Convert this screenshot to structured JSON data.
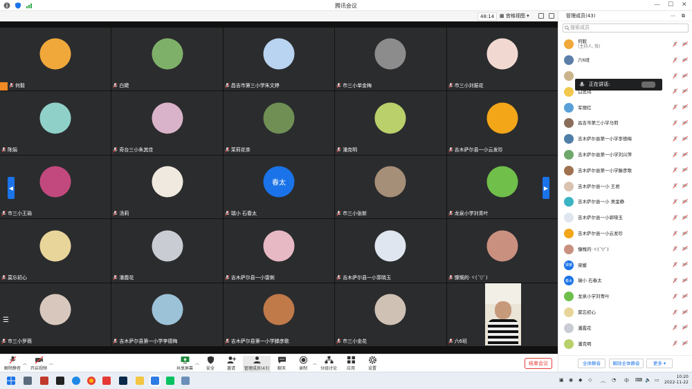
{
  "window": {
    "title": "腾讯会议"
  },
  "subbar": {
    "timer": "48:14",
    "view_label": "宫格视图"
  },
  "tiles": [
    {
      "name": "何毅",
      "avatar_color": "#f0a83a",
      "host": true
    },
    {
      "name": "白婕",
      "avatar_color": "#7fb069"
    },
    {
      "name": "昌吉市第三小学朱文婷",
      "avatar_color": "#b9d4f0"
    },
    {
      "name": "市三小单金梅",
      "avatar_color": "#8c8c8c"
    },
    {
      "name": "市三小刘振花",
      "avatar_color": "#f1d9d1"
    },
    {
      "name": "陈娟",
      "avatar_color": "#8fd1c8"
    },
    {
      "name": "奇台三小朱其佳",
      "avatar_color": "#d9b3c9"
    },
    {
      "name": "茉莉花茶",
      "avatar_color": "#6f8f55"
    },
    {
      "name": "潘克明",
      "avatar_color": "#b9d06b"
    },
    {
      "name": "吉木萨尔县一小云发珍",
      "avatar_color": "#f2a618"
    },
    {
      "name": "市三小王瑜",
      "avatar_color": "#c2497d"
    },
    {
      "name": "汤莉",
      "avatar_color": "#efe9df"
    },
    {
      "name": "瑞小 石春太",
      "avatar_text": "春太"
    },
    {
      "name": "市三小张新",
      "avatar_color": "#a68f78"
    },
    {
      "name": "龙泉小学刘青叶",
      "avatar_color": "#6fbf4a"
    },
    {
      "name": "莫忘初心",
      "avatar_color": "#e8d59a"
    },
    {
      "name": "潘霞花",
      "avatar_color": "#c9ccd3"
    },
    {
      "name": "吉木萨尔县一小雷俐",
      "avatar_color": "#e7b9c4"
    },
    {
      "name": "吉木萨尔县一小郭晓玉",
      "avatar_color": "#dfe6ef"
    },
    {
      "name": "慷慨的·ヾ(ˊ▽ˋ)",
      "avatar_color": "#c9907f"
    },
    {
      "name": "市三小罗薇",
      "avatar_color": "#d8c7bd"
    },
    {
      "name": "吉木萨尔县第一小学李德梅",
      "avatar_color": "#9cc2d8"
    },
    {
      "name": "吉木萨尔县第一小学滕彦歌",
      "avatar_color": "#c07a4a"
    },
    {
      "name": "市三小金花",
      "avatar_color": "#cfc1b4"
    },
    {
      "name": "六6班",
      "video": true
    }
  ],
  "toolbar": {
    "mute": "解除静音",
    "video": "开启视频",
    "share": "共享屏幕",
    "security": "安全",
    "invite": "邀请",
    "members": "管理成员(43)",
    "chat": "聊天",
    "record": "录制",
    "breakout": "分组讨论",
    "apps": "应用",
    "settings": "设置",
    "end": "结束会议"
  },
  "panel": {
    "title": "管理成员(43)",
    "search_placeholder": "搜索成员",
    "speaking_tip": "正在讲话:",
    "members": [
      {
        "name": "何毅",
        "sub": "(主持人, 我)",
        "color": "#f0a83a"
      },
      {
        "name": "六6班",
        "color": "#5b7fa8"
      },
      {
        "name": "",
        "color": "#c9b48b"
      },
      {
        "name": "白思玮",
        "color": "#f2c94c"
      },
      {
        "name": "军丽红",
        "color": "#5aa0d6"
      },
      {
        "name": "昌吉市第三小学马莉",
        "color": "#8a6d5a"
      },
      {
        "name": "吉木萨尔县第一小学李德梅",
        "color": "#4f7fa8"
      },
      {
        "name": "吉木萨尔县第一小学刘兴萍",
        "color": "#6fa86b"
      },
      {
        "name": "吉木萨尔县第一小学滕彦歌",
        "color": "#a0714f"
      },
      {
        "name": "吉木萨尔县一小 王君",
        "color": "#d9c3b0"
      },
      {
        "name": "吉木萨尔县一小 吴金静",
        "color": "#3bb4c4"
      },
      {
        "name": "吉木萨尔县一小郭晓玉",
        "color": "#dfe6ef"
      },
      {
        "name": "吉木萨尔县一小云发珍",
        "color": "#f2a618"
      },
      {
        "name": "慷慨的·ヾ(ˊ▽ˋ)",
        "color": "#c9907f"
      },
      {
        "name": "梁媛",
        "avatar_text": "梁媛"
      },
      {
        "name": "瑞小 石春太",
        "avatar_text": "春太"
      },
      {
        "name": "龙泉小学刘青叶",
        "color": "#6fbf4a"
      },
      {
        "name": "莫忘初心",
        "color": "#e8d59a"
      },
      {
        "name": "潘霞花",
        "color": "#c9ccd3"
      },
      {
        "name": "潘克明",
        "color": "#b9d06b"
      }
    ],
    "footer": {
      "mute_all": "全体静音",
      "unmute_all": "解除全体静音",
      "more": "更多"
    }
  },
  "taskbar": {
    "ime": "中",
    "time": "10:20",
    "date": "2022-11-22"
  }
}
